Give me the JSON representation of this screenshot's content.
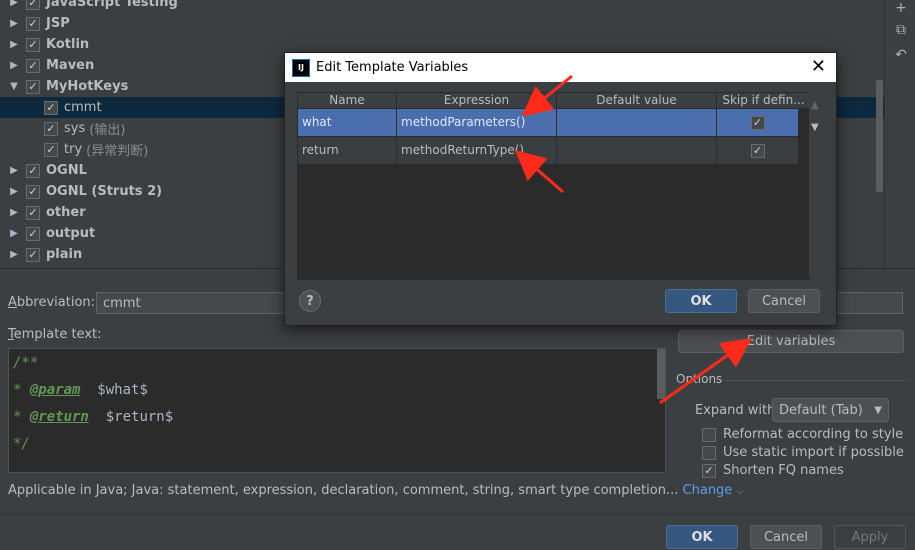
{
  "tree": {
    "items": [
      {
        "label": "JavaScript Testing",
        "kind": "group",
        "expanded": false,
        "checked": true
      },
      {
        "label": "JSP",
        "kind": "group",
        "expanded": false,
        "checked": true
      },
      {
        "label": "Kotlin",
        "kind": "group",
        "expanded": false,
        "checked": true
      },
      {
        "label": "Maven",
        "kind": "group",
        "expanded": false,
        "checked": true
      },
      {
        "label": "MyHotKeys",
        "kind": "group",
        "expanded": true,
        "checked": true
      },
      {
        "label": "cmmt",
        "kind": "child",
        "checked": true,
        "selected": true,
        "desc": ""
      },
      {
        "label": "sys",
        "kind": "child",
        "checked": true,
        "desc": "(输出)"
      },
      {
        "label": "try",
        "kind": "child",
        "checked": true,
        "desc": "(异常判断)"
      },
      {
        "label": "OGNL",
        "kind": "group",
        "expanded": false,
        "checked": true
      },
      {
        "label": "OGNL (Struts 2)",
        "kind": "group",
        "expanded": false,
        "checked": true
      },
      {
        "label": "other",
        "kind": "group",
        "expanded": false,
        "checked": true
      },
      {
        "label": "output",
        "kind": "group",
        "expanded": false,
        "checked": true
      },
      {
        "label": "plain",
        "kind": "group",
        "expanded": false,
        "checked": true
      }
    ]
  },
  "toolbar_icons": [
    "add-icon",
    "copy-icon",
    "restore-icon"
  ],
  "abbreviation": {
    "label": "Abbreviation:",
    "value": "cmmt"
  },
  "template_text": {
    "label": "Template text:",
    "lines": [
      {
        "prefix": "/**",
        "tag": "",
        "var": ""
      },
      {
        "prefix": "* ",
        "tag": "@param",
        "var": "$what$"
      },
      {
        "prefix": "* ",
        "tag": "@return",
        "var": "$return$"
      },
      {
        "prefix": "*/",
        "tag": "",
        "var": ""
      }
    ]
  },
  "edit_variables_label": "Edit variables",
  "options": {
    "title": "Options",
    "expand_with_label": "Expand with",
    "expand_with_value": "Default (Tab)",
    "checkboxes": [
      {
        "label": "Reformat according to style",
        "checked": false
      },
      {
        "label": "Use static import if possible",
        "checked": false
      },
      {
        "label": "Shorten FQ names",
        "checked": true
      }
    ]
  },
  "applicable": {
    "text": "Applicable in Java; Java: statement, expression, declaration, comment, string, smart type completion...",
    "change_label": "Change"
  },
  "footer": {
    "ok": "OK",
    "cancel": "Cancel",
    "apply": "Apply"
  },
  "dialog": {
    "logo": "IJ",
    "title": "Edit Template Variables",
    "columns": [
      "Name",
      "Expression",
      "Default value",
      "Skip if defin..."
    ],
    "rows": [
      {
        "name": "what",
        "expression": "methodParameters()",
        "default": "",
        "skip": true,
        "selected": true
      },
      {
        "name": "return",
        "expression": "methodReturnType()",
        "default": "",
        "skip": true,
        "selected": false
      }
    ],
    "help": "?",
    "ok": "OK",
    "cancel": "Cancel"
  },
  "colors": {
    "background": "#3c3f41",
    "selection": "#4b6eaf",
    "tree_selection": "#0d293e",
    "annotation_arrow": "#ff2a1a",
    "link": "#589df6"
  }
}
